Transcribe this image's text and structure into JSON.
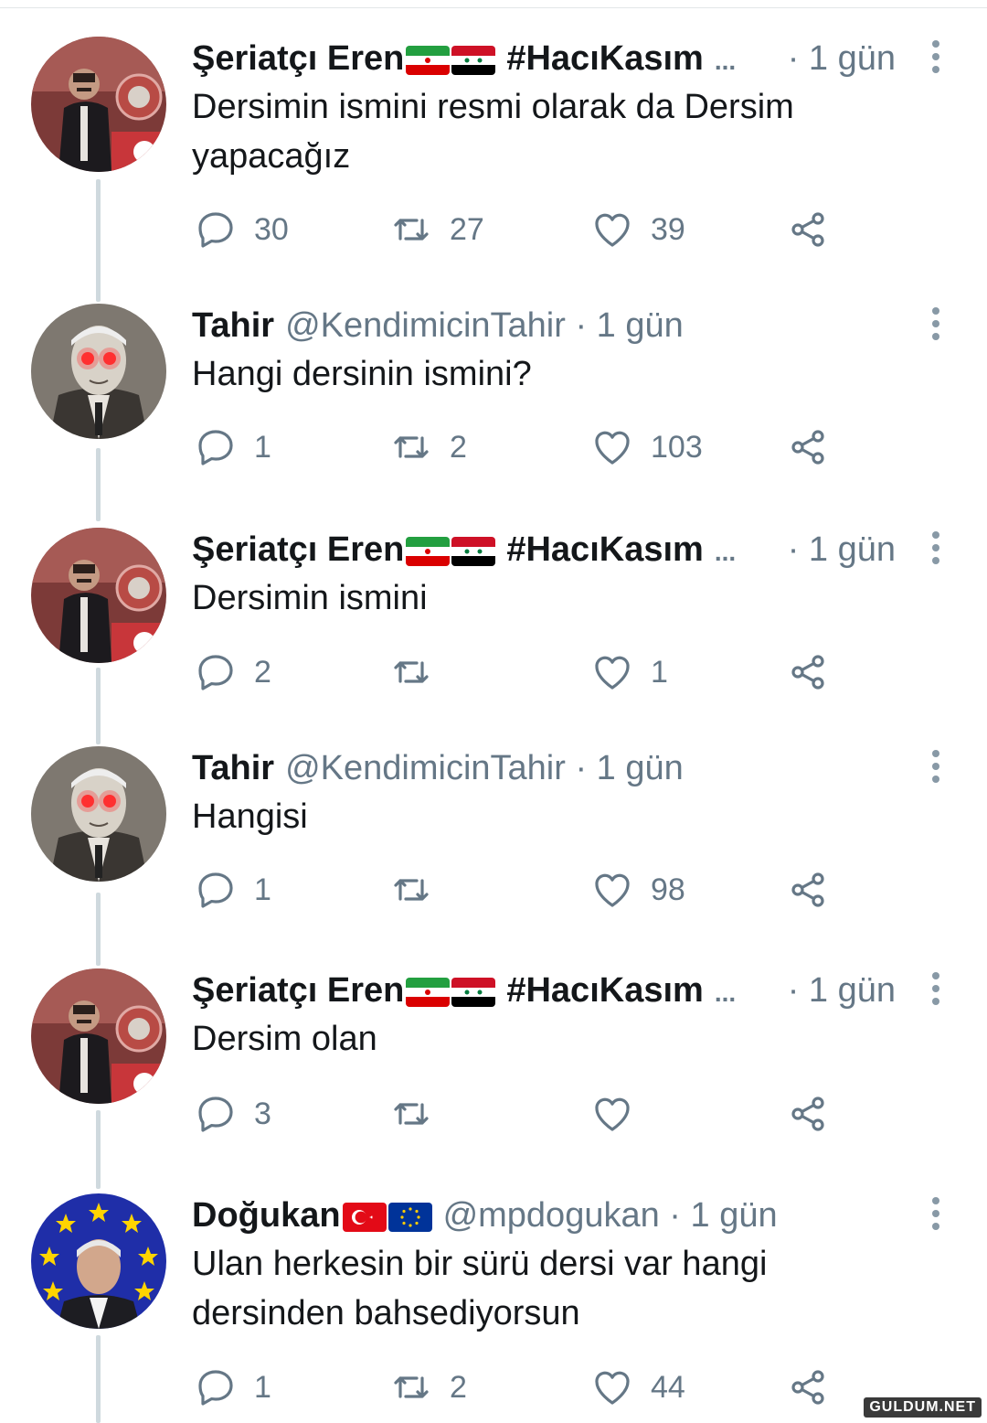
{
  "tweets": [
    {
      "name": "Şeriatçı Eren",
      "flags": [
        "iran-flag",
        "syria-flag"
      ],
      "hashtag": "#HacıKasım",
      "ellipsis": "...",
      "handle": "",
      "time": "· 1 gün",
      "text": "Dersimin ismini resmi olarak da Dersim yapacağız",
      "replies": "30",
      "retweets": "27",
      "likes": "39",
      "avatar": "parliament-speaker-avatar"
    },
    {
      "name": "Tahir",
      "flags": [],
      "hashtag": "",
      "ellipsis": "",
      "handle": "@KendimicinTahir",
      "time": "· 1 gün",
      "text": "Hangi dersinin ismini?",
      "replies": "1",
      "retweets": "2",
      "likes": "103",
      "avatar": "old-man-red-eyes-avatar"
    },
    {
      "name": "Şeriatçı Eren",
      "flags": [
        "iran-flag",
        "syria-flag"
      ],
      "hashtag": "#HacıKasım",
      "ellipsis": "...",
      "handle": "",
      "time": "· 1 gün",
      "text": "Dersimin ismini",
      "replies": "2",
      "retweets": "",
      "likes": "1",
      "avatar": "parliament-speaker-avatar"
    },
    {
      "name": "Tahir",
      "flags": [],
      "hashtag": "",
      "ellipsis": "",
      "handle": "@KendimicinTahir",
      "time": "· 1 gün",
      "text": "Hangisi",
      "replies": "1",
      "retweets": "",
      "likes": "98",
      "avatar": "old-man-red-eyes-avatar"
    },
    {
      "name": "Şeriatçı Eren",
      "flags": [
        "iran-flag",
        "syria-flag"
      ],
      "hashtag": "#HacıKasım",
      "ellipsis": "...",
      "handle": "",
      "time": "· 1 gün",
      "text": "Dersim olan",
      "replies": "3",
      "retweets": "",
      "likes": "",
      "avatar": "parliament-speaker-avatar"
    },
    {
      "name": "Doğukan",
      "flags": [
        "turkey-flag",
        "eu-flag"
      ],
      "hashtag": "",
      "ellipsis": "",
      "handle": "@mpdogukan",
      "time": "· 1 gün",
      "text": "Ulan herkesin bir sürü dersi var hangi dersinden bahsediyorsun",
      "replies": "1",
      "retweets": "2",
      "likes": "44",
      "avatar": "eu-stars-avatar"
    }
  ],
  "icons": {
    "reply": "reply-icon",
    "retweet": "retweet-icon",
    "like": "heart-icon",
    "share": "share-icon",
    "more": "more-vertical-icon"
  },
  "colors": {
    "text": "#14171a",
    "muted": "#657786",
    "thread_line": "#cfd9de",
    "icon": "#657786"
  },
  "watermark": "GULDUM.NET"
}
